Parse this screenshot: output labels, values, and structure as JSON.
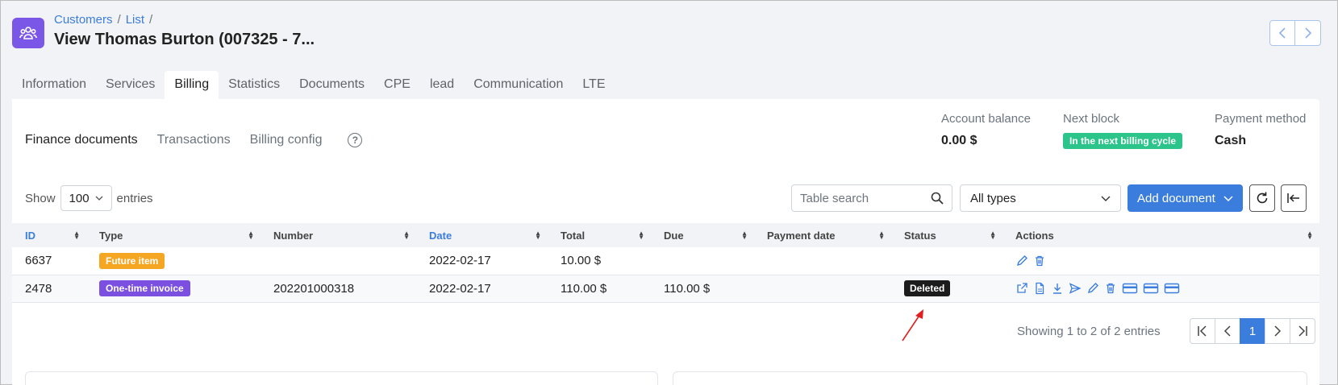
{
  "breadcrumb": {
    "items": [
      "Customers",
      "List"
    ],
    "separator": "/"
  },
  "title": "View Thomas Burton (007325 - 7...",
  "tabs": [
    "Information",
    "Services",
    "Billing",
    "Statistics",
    "Documents",
    "CPE",
    "lead",
    "Communication",
    "LTE"
  ],
  "active_tab": "Billing",
  "subtabs": [
    "Finance documents",
    "Transactions",
    "Billing config"
  ],
  "help_label": "?",
  "summary": {
    "account_balance_label": "Account balance",
    "account_balance_value": "0.00 $",
    "next_block_label": "Next block",
    "next_block_badge": "In the next billing cycle",
    "payment_method_label": "Payment method",
    "payment_method_value": "Cash"
  },
  "controls": {
    "show_label": "Show",
    "entries_value": "100",
    "entries_label": "entries",
    "search_placeholder": "Table search",
    "type_filter": "All types",
    "add_document": "Add document"
  },
  "table": {
    "columns": [
      "ID",
      "Type",
      "Number",
      "Date",
      "Total",
      "Due",
      "Payment date",
      "Status",
      "Actions"
    ],
    "rows": [
      {
        "id": "6637",
        "type": "Future item",
        "number": "",
        "date": "2022-02-17",
        "total": "10.00 $",
        "due": "",
        "payment_date": "",
        "status": ""
      },
      {
        "id": "2478",
        "type": "One-time invoice",
        "number": "202201000318",
        "date": "2022-02-17",
        "total": "110.00 $",
        "due": "110.00 $",
        "payment_date": "",
        "status": "Deleted"
      }
    ]
  },
  "pagination": {
    "info": "Showing 1 to 2 of 2 entries",
    "current_page": "1"
  },
  "colors": {
    "accent": "#3b7ddd",
    "app_icon": "#7b57e8",
    "future_item": "#f5a623",
    "one_time_invoice": "#7b4fe0",
    "next_block": "#2bc48a",
    "deleted": "#1c1c1c",
    "annotation_arrow": "#e02020"
  }
}
